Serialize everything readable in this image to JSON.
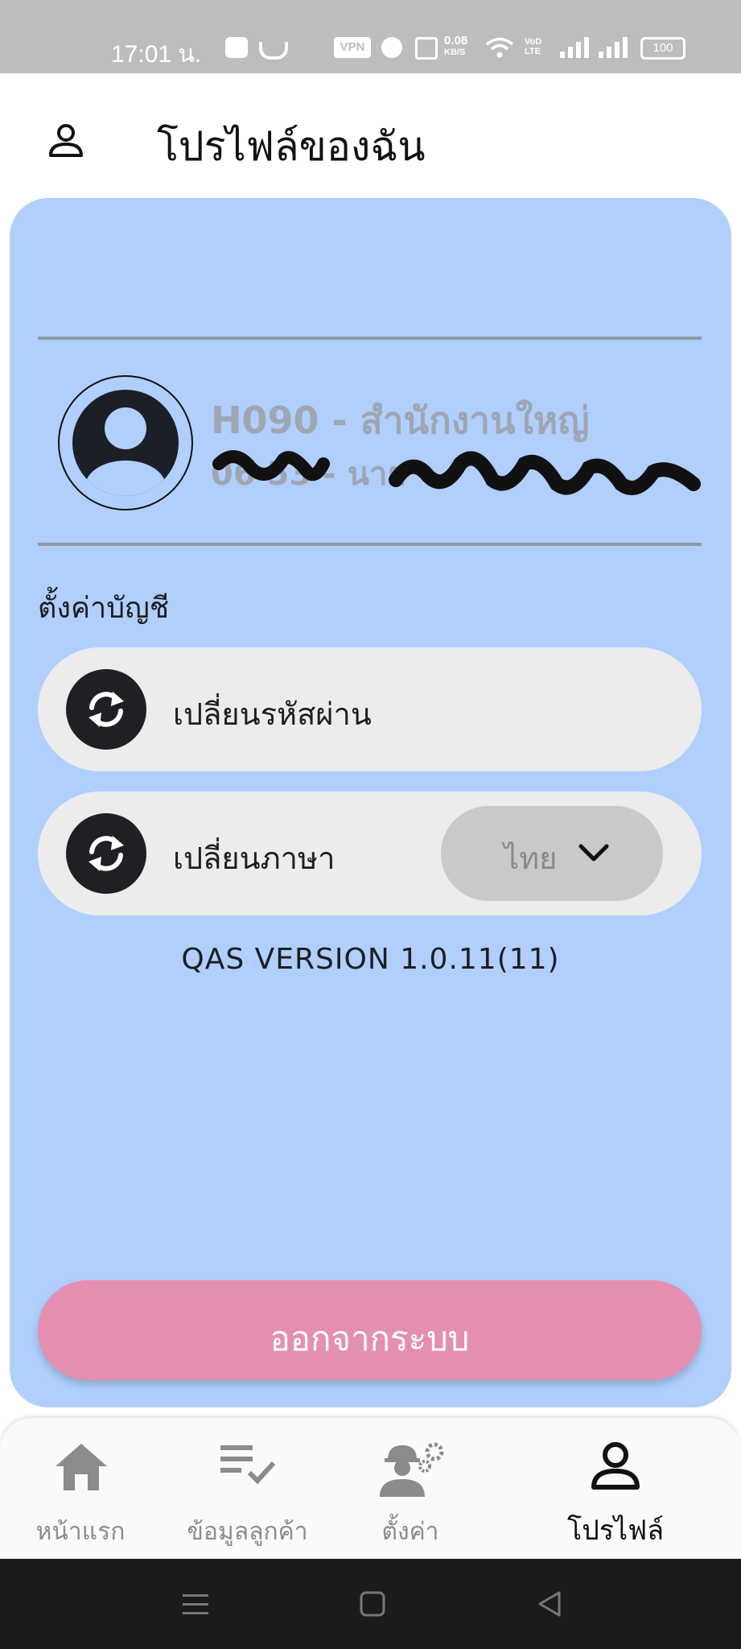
{
  "status_bar": {
    "time": "17:01 น.",
    "vpn_label": "VPN",
    "net_speed": "0.08",
    "net_speed_unit": "KB/S",
    "volte_label": "VoD LTE",
    "battery": "100"
  },
  "header": {
    "icon": "user-icon",
    "title": "โปรไฟล์ของฉัน"
  },
  "profile": {
    "avatar_icon": "account-circle-icon",
    "branch": "H090 - สำนักงานใหญ่",
    "user_line": "06 53 - นาย"
  },
  "account_settings": {
    "section_label": "ตั้งค่าบัญชี",
    "change_password_label": "เปลี่ยนรหัสผ่าน",
    "change_language_label": "เปลี่ยนภาษา",
    "language_value": "ไทย",
    "row_icon": "sync-icon"
  },
  "version": "QAS VERSION 1.0.11(11)",
  "logout_label": "ออกจากระบบ",
  "bottom_nav": [
    {
      "label": "หน้าแรก",
      "icon": "home-icon"
    },
    {
      "label": "ข้อมูลลูกค้า",
      "icon": "checklist-icon"
    },
    {
      "label": "ตั้งค่า",
      "icon": "worker-settings-icon"
    },
    {
      "label": "โปรไฟล์",
      "icon": "person-icon",
      "active": true
    }
  ],
  "colors": {
    "card_bg": "#b0cffc",
    "logout_bg": "#e48fb2",
    "row_bg": "#ececec",
    "dark": "#1f2024"
  }
}
